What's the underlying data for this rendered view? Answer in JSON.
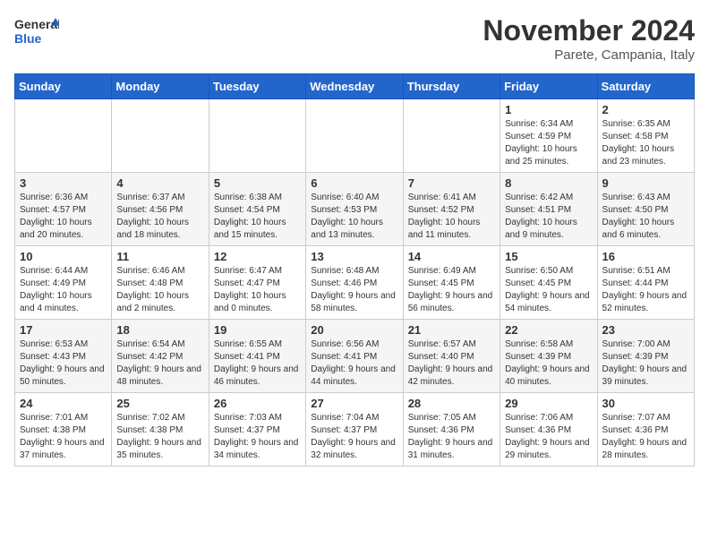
{
  "header": {
    "logo_general": "General",
    "logo_blue": "Blue",
    "month_title": "November 2024",
    "location": "Parete, Campania, Italy"
  },
  "calendar": {
    "days_of_week": [
      "Sunday",
      "Monday",
      "Tuesday",
      "Wednesday",
      "Thursday",
      "Friday",
      "Saturday"
    ],
    "weeks": [
      [
        {
          "day": "",
          "info": ""
        },
        {
          "day": "",
          "info": ""
        },
        {
          "day": "",
          "info": ""
        },
        {
          "day": "",
          "info": ""
        },
        {
          "day": "",
          "info": ""
        },
        {
          "day": "1",
          "info": "Sunrise: 6:34 AM\nSunset: 4:59 PM\nDaylight: 10 hours and 25 minutes."
        },
        {
          "day": "2",
          "info": "Sunrise: 6:35 AM\nSunset: 4:58 PM\nDaylight: 10 hours and 23 minutes."
        }
      ],
      [
        {
          "day": "3",
          "info": "Sunrise: 6:36 AM\nSunset: 4:57 PM\nDaylight: 10 hours and 20 minutes."
        },
        {
          "day": "4",
          "info": "Sunrise: 6:37 AM\nSunset: 4:56 PM\nDaylight: 10 hours and 18 minutes."
        },
        {
          "day": "5",
          "info": "Sunrise: 6:38 AM\nSunset: 4:54 PM\nDaylight: 10 hours and 15 minutes."
        },
        {
          "day": "6",
          "info": "Sunrise: 6:40 AM\nSunset: 4:53 PM\nDaylight: 10 hours and 13 minutes."
        },
        {
          "day": "7",
          "info": "Sunrise: 6:41 AM\nSunset: 4:52 PM\nDaylight: 10 hours and 11 minutes."
        },
        {
          "day": "8",
          "info": "Sunrise: 6:42 AM\nSunset: 4:51 PM\nDaylight: 10 hours and 9 minutes."
        },
        {
          "day": "9",
          "info": "Sunrise: 6:43 AM\nSunset: 4:50 PM\nDaylight: 10 hours and 6 minutes."
        }
      ],
      [
        {
          "day": "10",
          "info": "Sunrise: 6:44 AM\nSunset: 4:49 PM\nDaylight: 10 hours and 4 minutes."
        },
        {
          "day": "11",
          "info": "Sunrise: 6:46 AM\nSunset: 4:48 PM\nDaylight: 10 hours and 2 minutes."
        },
        {
          "day": "12",
          "info": "Sunrise: 6:47 AM\nSunset: 4:47 PM\nDaylight: 10 hours and 0 minutes."
        },
        {
          "day": "13",
          "info": "Sunrise: 6:48 AM\nSunset: 4:46 PM\nDaylight: 9 hours and 58 minutes."
        },
        {
          "day": "14",
          "info": "Sunrise: 6:49 AM\nSunset: 4:45 PM\nDaylight: 9 hours and 56 minutes."
        },
        {
          "day": "15",
          "info": "Sunrise: 6:50 AM\nSunset: 4:45 PM\nDaylight: 9 hours and 54 minutes."
        },
        {
          "day": "16",
          "info": "Sunrise: 6:51 AM\nSunset: 4:44 PM\nDaylight: 9 hours and 52 minutes."
        }
      ],
      [
        {
          "day": "17",
          "info": "Sunrise: 6:53 AM\nSunset: 4:43 PM\nDaylight: 9 hours and 50 minutes."
        },
        {
          "day": "18",
          "info": "Sunrise: 6:54 AM\nSunset: 4:42 PM\nDaylight: 9 hours and 48 minutes."
        },
        {
          "day": "19",
          "info": "Sunrise: 6:55 AM\nSunset: 4:41 PM\nDaylight: 9 hours and 46 minutes."
        },
        {
          "day": "20",
          "info": "Sunrise: 6:56 AM\nSunset: 4:41 PM\nDaylight: 9 hours and 44 minutes."
        },
        {
          "day": "21",
          "info": "Sunrise: 6:57 AM\nSunset: 4:40 PM\nDaylight: 9 hours and 42 minutes."
        },
        {
          "day": "22",
          "info": "Sunrise: 6:58 AM\nSunset: 4:39 PM\nDaylight: 9 hours and 40 minutes."
        },
        {
          "day": "23",
          "info": "Sunrise: 7:00 AM\nSunset: 4:39 PM\nDaylight: 9 hours and 39 minutes."
        }
      ],
      [
        {
          "day": "24",
          "info": "Sunrise: 7:01 AM\nSunset: 4:38 PM\nDaylight: 9 hours and 37 minutes."
        },
        {
          "day": "25",
          "info": "Sunrise: 7:02 AM\nSunset: 4:38 PM\nDaylight: 9 hours and 35 minutes."
        },
        {
          "day": "26",
          "info": "Sunrise: 7:03 AM\nSunset: 4:37 PM\nDaylight: 9 hours and 34 minutes."
        },
        {
          "day": "27",
          "info": "Sunrise: 7:04 AM\nSunset: 4:37 PM\nDaylight: 9 hours and 32 minutes."
        },
        {
          "day": "28",
          "info": "Sunrise: 7:05 AM\nSunset: 4:36 PM\nDaylight: 9 hours and 31 minutes."
        },
        {
          "day": "29",
          "info": "Sunrise: 7:06 AM\nSunset: 4:36 PM\nDaylight: 9 hours and 29 minutes."
        },
        {
          "day": "30",
          "info": "Sunrise: 7:07 AM\nSunset: 4:36 PM\nDaylight: 9 hours and 28 minutes."
        }
      ]
    ]
  }
}
